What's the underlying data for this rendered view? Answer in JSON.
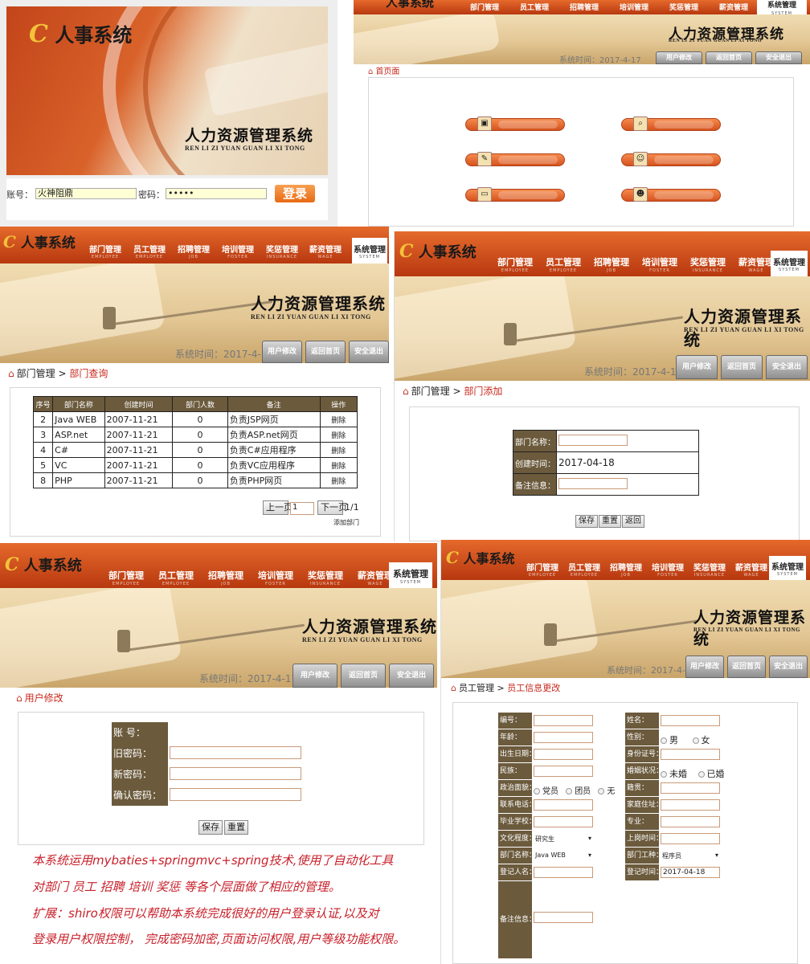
{
  "login": {
    "brand": "人事系统",
    "title": "人力资源管理系统",
    "subtitle": "REN LI ZI YUAN GUAN LI XI TONG",
    "account_label": "账号：",
    "account_value": "火神阻鼎",
    "password_label": "密码：",
    "password_value": "•••••",
    "login_button": "登录"
  },
  "header": {
    "brand": "人事系统",
    "nav": [
      "部门管理",
      "员工管理",
      "招聘管理",
      "培训管理",
      "奖惩管理",
      "薪资管理"
    ],
    "nav_en": [
      "EMPLOYEE",
      "EMPLOYEE",
      "JOB",
      "FOSTER",
      "INSURANCE",
      "WAGE"
    ],
    "active": "系统管理",
    "active_en": "SYSTEM",
    "title": "人力资源管理系统",
    "subtitle": "REN LI ZI YUAN GUAN LI XI TONG",
    "system_time": "系统时间：2017-4-17",
    "buttons": [
      "用户修改",
      "返回首页",
      "安全退出"
    ]
  },
  "home": {
    "breadcrumb": "首页面"
  },
  "dept_query": {
    "breadcrumb_parent": "部门管理",
    "breadcrumb_sep": ">",
    "breadcrumb_current": "部门查询",
    "columns": [
      "序号",
      "部门名称",
      "创建时间",
      "部门人数",
      "备注",
      "操作"
    ],
    "rows": [
      [
        "2",
        "Java WEB",
        "2007-11-21",
        "0",
        "负责JSP网页",
        "删除"
      ],
      [
        "3",
        "ASP.net",
        "2007-11-21",
        "0",
        "负责ASP.net网页",
        "删除"
      ],
      [
        "4",
        "C#",
        "2007-11-21",
        "0",
        "负责C#应用程序",
        "删除"
      ],
      [
        "5",
        "VC",
        "2007-11-21",
        "0",
        "负责VC应用程序",
        "删除"
      ],
      [
        "8",
        "PHP",
        "2007-11-21",
        "0",
        "负责PHP网页",
        "删除"
      ]
    ],
    "prev": "上一页",
    "page_input": "1",
    "next": "下一页",
    "page_info": "1/1",
    "add_link": "添加部门"
  },
  "dept_add": {
    "breadcrumb_parent": "部门管理",
    "breadcrumb_sep": ">",
    "breadcrumb_current": "部门添加",
    "name_label": "部门名称：",
    "date_label": "创建时间：",
    "date_value": "2017-04-18",
    "note_label": "备注信息：",
    "save": "保存",
    "reset": "重置",
    "back": "返回"
  },
  "user_edit": {
    "breadcrumb_current": "用户修改",
    "account_label": "账  号：",
    "old_pwd_label": "旧密码：",
    "new_pwd_label": "新密码：",
    "confirm_pwd_label": "确认密码：",
    "save": "保存",
    "reset": "重置"
  },
  "emp_edit": {
    "breadcrumb_parent": "员工管理",
    "breadcrumb_sep": ">",
    "breadcrumb_current": "员工信息更改",
    "left_labels": [
      "编号：",
      "年龄：",
      "出生日期：",
      "民族：",
      "政治面貌：",
      "联系电话：",
      "毕业学校：",
      "文化程度：",
      "部门名称：",
      "登记人名："
    ],
    "right_labels": [
      "姓名：",
      "性别：",
      "身份证号：",
      "婚姻状况：",
      "籍贯：",
      "家庭住址：",
      "专业：",
      "上岗时间：",
      "部门工种：",
      "登记时间："
    ],
    "gender_options": [
      "男",
      "女"
    ],
    "marital_options": [
      "未婚",
      "已婚"
    ],
    "political_options": [
      "党员",
      "团员",
      "无"
    ],
    "education_value": "研究生",
    "dept_value": "Java WEB",
    "job_value": "程序员",
    "register_time_value": "2017-04-18",
    "remark_label": "备注信息："
  },
  "caption": {
    "lines": [
      "本系统运用mybaties+springmvc+spring技术,使用了自动化工具",
      "对部门 员工 招聘 培训 奖惩 等各个层面做了相应的管理。",
      "扩展：shiro权限可以帮助本系统完成很好的用户登录认证,以及对",
      "登录用户权限控制，  完成密码加密,页面访问权限,用户等级功能权限。"
    ]
  },
  "colors": {
    "header_red": "#c8481a",
    "label_brown": "#6b5a3c",
    "crumb_red": "#c8281c",
    "caption_red": "#c8202a"
  }
}
